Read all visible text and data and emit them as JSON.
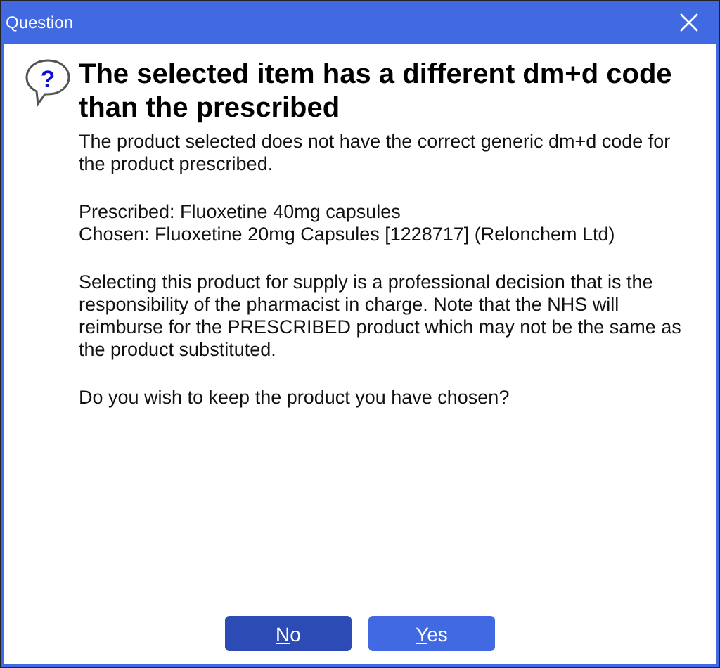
{
  "window": {
    "title": "Question"
  },
  "icon_glyph": "?",
  "heading": "The selected item has a different dm+d code than the prescribed",
  "paragraphs": [
    {
      "lines": [
        "The product selected does not have the correct generic dm+d code for the product prescribed."
      ]
    },
    {
      "lines": [
        "Prescribed: Fluoxetine 40mg capsules",
        "Chosen: Fluoxetine 20mg Capsules [1228717] (Relonchem Ltd)"
      ]
    },
    {
      "lines": [
        "Selecting this product for supply is a professional decision that is the responsibility of the pharmacist in charge.  Note that the NHS will reimburse for the PRESCRIBED product which may not be the same as the product substituted."
      ]
    },
    {
      "lines": [
        "Do you wish to keep the product you have chosen?"
      ]
    }
  ],
  "buttons": [
    {
      "key": "N",
      "rest": "o",
      "selected": true
    },
    {
      "key": "Y",
      "rest": "es",
      "selected": false
    }
  ]
}
